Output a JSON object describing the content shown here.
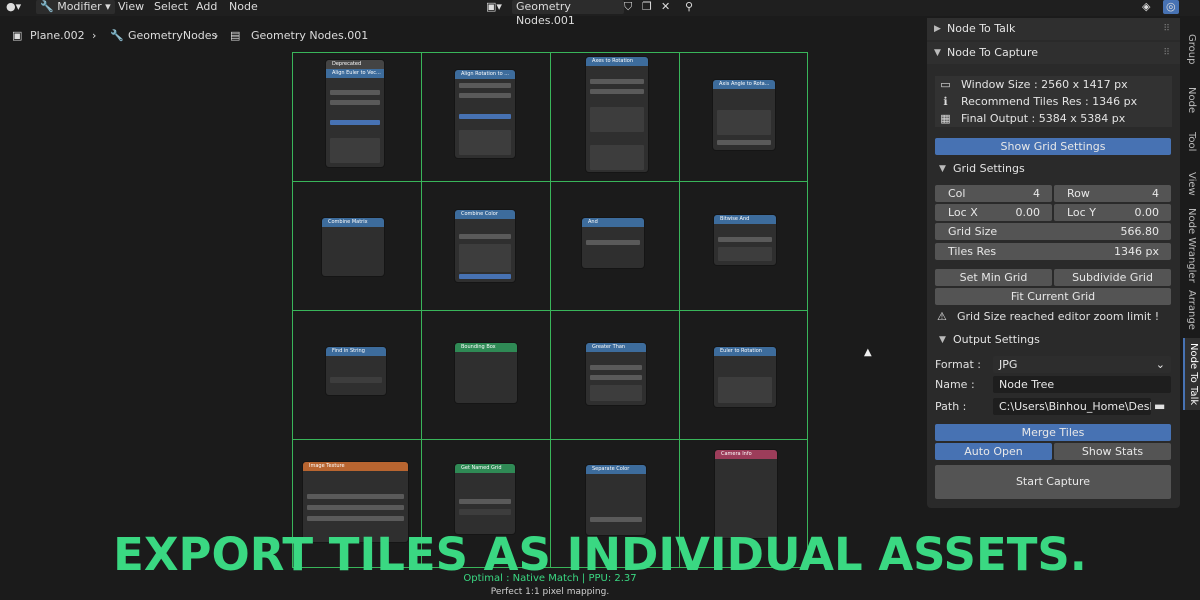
{
  "topbar": {
    "mode": "Modifier",
    "menus": [
      "View",
      "Select",
      "Add",
      "Node"
    ],
    "editor_title": "Geometry Nodes.001"
  },
  "breadcrumb": [
    "Plane.002",
    "GeometryNodes",
    "Geometry Nodes.001"
  ],
  "nodes": [
    {
      "title": "Align Euler to Vec...",
      "color": "#3d6c9c"
    },
    {
      "title": "Align Rotation to ...",
      "color": "#3d6c9c"
    },
    {
      "title": "Axes to Rotation",
      "color": "#3d6c9c"
    },
    {
      "title": "Axis Angle to Rota...",
      "color": "#3d6c9c"
    },
    {
      "title": "Combine Matrix",
      "color": "#3d6c9c"
    },
    {
      "title": "Combine Color",
      "color": "#3d6c9c"
    },
    {
      "title": "And",
      "color": "#3d6c9c"
    },
    {
      "title": "Bitwise And",
      "color": "#3d6c9c"
    },
    {
      "title": "Find in String",
      "color": "#3d6c9c"
    },
    {
      "title": "Bounding Box",
      "color": "#2f8a55"
    },
    {
      "title": "Greater Than",
      "color": "#3d6c9c"
    },
    {
      "title": "Euler to Rotation",
      "color": "#3d6c9c"
    },
    {
      "title": "Image Texture",
      "color": "#b86530"
    },
    {
      "title": "Get Named Grid",
      "color": "#2f8a55"
    },
    {
      "title": "Separate Color",
      "color": "#3d6c9c"
    },
    {
      "title": "Camera Info",
      "color": "#9c3d5a"
    }
  ],
  "deprecated_label": "Deprecated",
  "panel": {
    "node_to_talk": "Node To Talk",
    "node_to_capture": "Node To Capture",
    "window_size": "Window Size : 2560 x 1417 px",
    "recommend_tiles": "Recommend Tiles Res : 1346 px",
    "final_output": "Final Output : 5384 x 5384 px",
    "show_grid_settings": "Show Grid Settings",
    "grid_settings": "Grid Settings",
    "col_label": "Col",
    "col_value": "4",
    "row_label": "Row",
    "row_value": "4",
    "locx_label": "Loc X",
    "locx_value": "0.00",
    "locy_label": "Loc Y",
    "locy_value": "0.00",
    "gridsize_label": "Grid Size",
    "gridsize_value": "566.80",
    "tilesres_label": "Tiles Res",
    "tilesres_value": "1346 px",
    "set_min_grid": "Set Min Grid",
    "subdivide_grid": "Subdivide Grid",
    "fit_current_grid": "Fit Current Grid",
    "warning": "Grid Size reached editor zoom limit !",
    "output_settings": "Output Settings",
    "format_label": "Format :",
    "format_value": "JPG",
    "name_label": "Name :",
    "name_value": "Node Tree",
    "path_label": "Path :",
    "path_value": "C:\\Users\\Binhou_Home\\Deskto...",
    "merge_tiles": "Merge Tiles",
    "auto_open": "Auto Open",
    "show_stats": "Show Stats",
    "start_capture": "Start Capture"
  },
  "side_tabs": [
    "Group",
    "Node",
    "Tool",
    "View",
    "Node Wrangler",
    "Arrange",
    "Node To Talk"
  ],
  "status": {
    "line1": "Optimal : Native Match | PPU: 2.37",
    "line2": "Perfect 1:1 pixel mapping."
  },
  "caption": "EXPORT TILES AS INDIVIDUAL ASSETS.",
  "colors": {
    "accent": "#4772b3",
    "grid": "#39b55a",
    "caption": "#3ad882",
    "background": "#1b1b1b"
  }
}
